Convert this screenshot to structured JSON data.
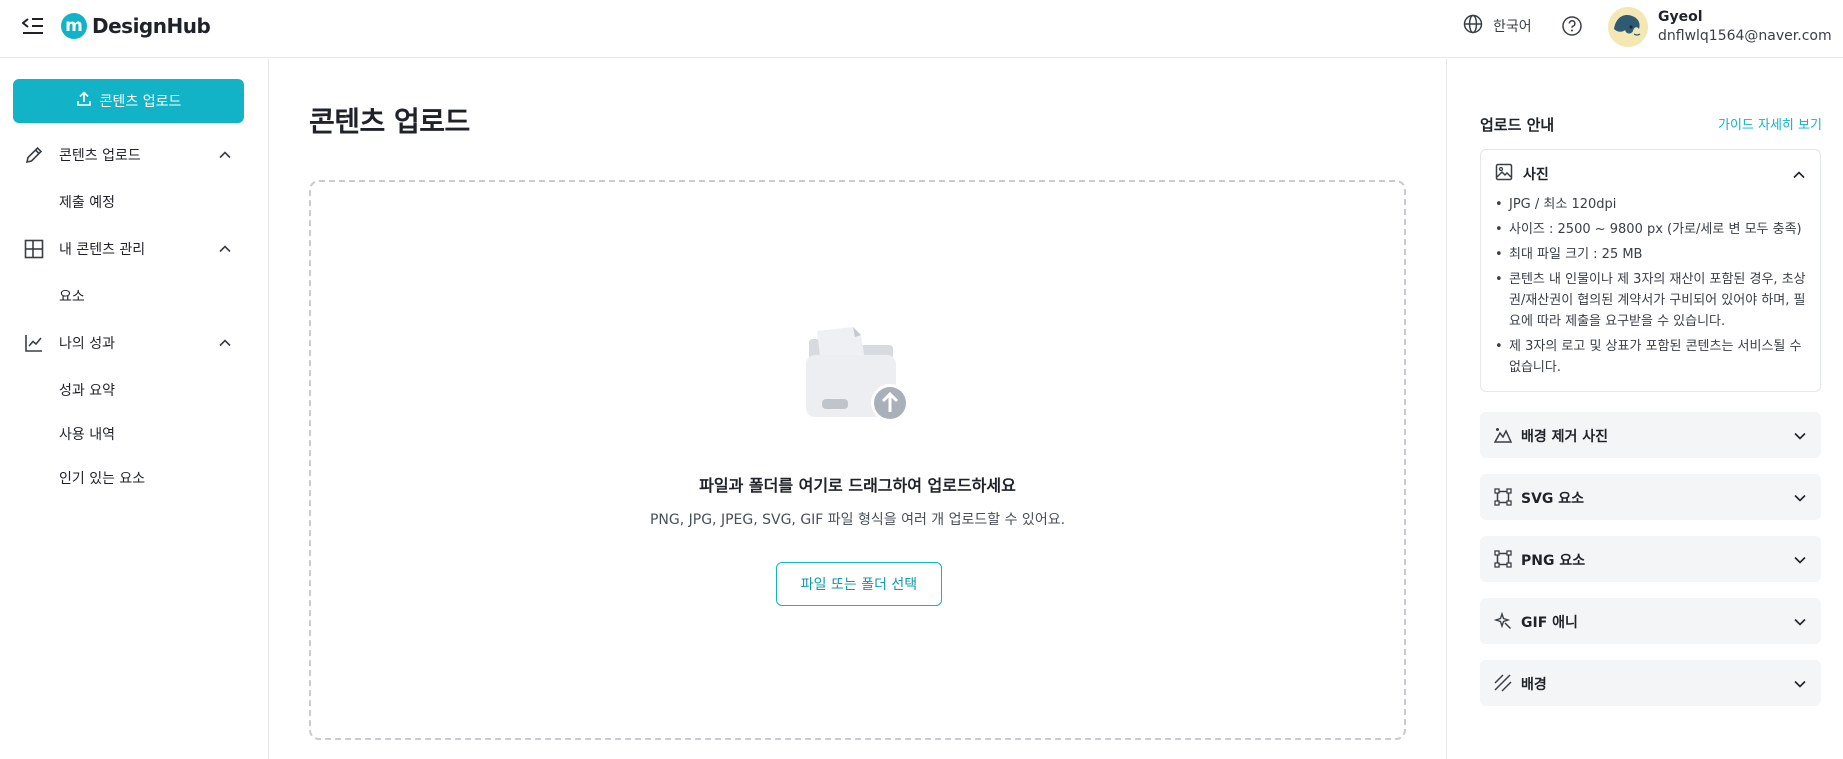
{
  "brand": {
    "name": "DesignHub",
    "accent": "#12b3c6"
  },
  "header": {
    "language": "한국어",
    "user": {
      "name": "Gyeol",
      "email": "dnflwlq1564@naver.com"
    }
  },
  "sidebar": {
    "upload_button": "콘텐츠 업로드",
    "groups": [
      {
        "label": "콘텐츠 업로드",
        "icon": "pencil-icon",
        "items": [
          "제출 예정"
        ]
      },
      {
        "label": "내 콘텐츠 관리",
        "icon": "layout-grid-icon",
        "items": [
          "요소"
        ]
      },
      {
        "label": "나의 성과",
        "icon": "chart-line-icon",
        "items": [
          "성과 요약",
          "사용 내역",
          "인기 있는 요소"
        ]
      }
    ]
  },
  "main": {
    "title": "콘텐츠 업로드",
    "dropzone": {
      "title": "파일과 폴더를 여기로 드래그하여 업로드하세요",
      "description": "PNG, JPG, JPEG, SVG, GIF 파일 형식을 여러 개 업로드할 수 있어요.",
      "button": "파일 또는 폴더 선택"
    }
  },
  "guide": {
    "title": "업로드 안내",
    "link": "가이드 자세히 보기",
    "open_section": {
      "label": "사진",
      "icon": "image-icon",
      "items": [
        "JPG / 최소 120dpi",
        "사이즈 : 2500 ~ 9800 px (가로/세로 변 모두 충족)",
        "최대 파일 크기 : 25 MB",
        "콘텐츠 내 인물이나 제 3자의 재산이 포함된 경우, 초상권/재산권이 협의된 계약서가 구비되어 있어야 하며, 필요에 따라 제출을 요구받을 수 있습니다.",
        "제 3자의 로고 및 상표가 포함된 콘텐츠는 서비스될 수 없습니다."
      ]
    },
    "sections": [
      {
        "label": "배경 제거 사진",
        "icon": "mountain-icon"
      },
      {
        "label": "SVG 요소",
        "icon": "vector-icon"
      },
      {
        "label": "PNG 요소",
        "icon": "vector-icon"
      },
      {
        "label": "GIF 애니",
        "icon": "sparkle-icon"
      },
      {
        "label": "배경",
        "icon": "pattern-icon"
      }
    ]
  }
}
